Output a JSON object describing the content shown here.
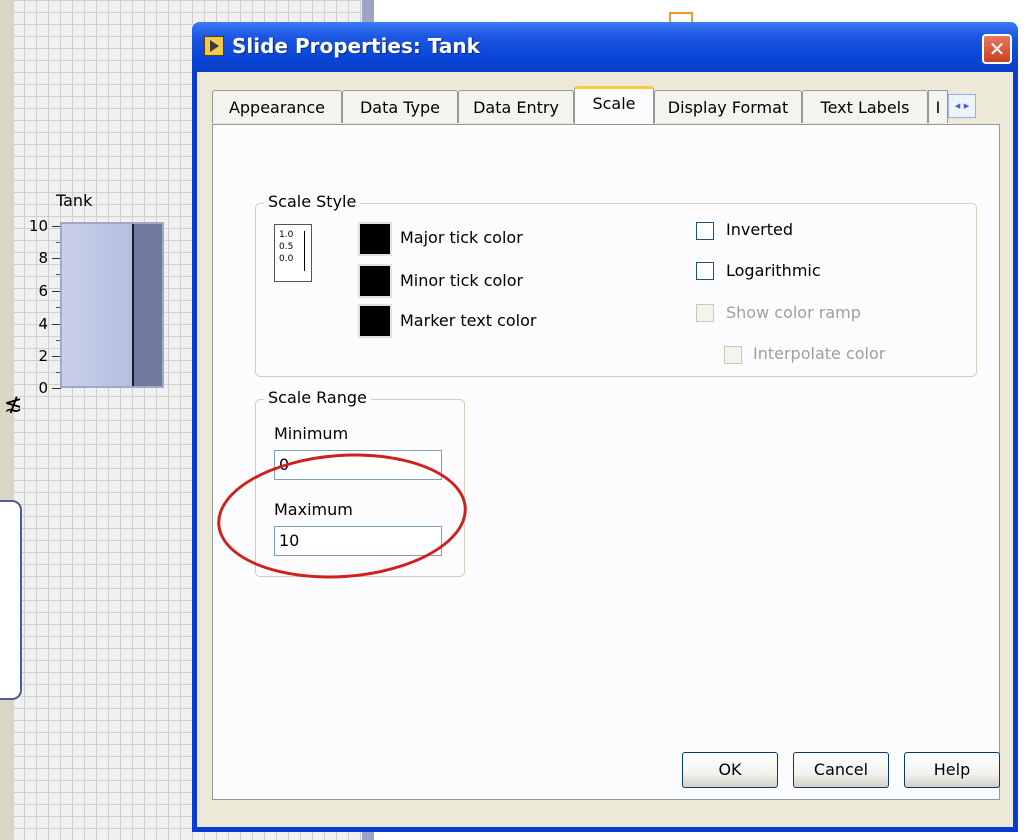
{
  "background": {
    "indicator_label": "Tank",
    "scale_ticks": [
      "10",
      "8",
      "6",
      "4",
      "2",
      "0"
    ]
  },
  "dialog": {
    "title": "Slide Properties: Tank",
    "close_glyph": "✕",
    "tabs": [
      "Appearance",
      "Data Type",
      "Data Entry",
      "Scale",
      "Display Format",
      "Text Labels",
      "I"
    ],
    "active_tab": "Scale",
    "tab_scroll_arrows": "◂ ▸",
    "scale_style": {
      "title": "Scale Style",
      "icon_labels": [
        "1.0",
        "0.5",
        "0.0"
      ],
      "colors": [
        {
          "label": "Major tick color",
          "color": "#000000"
        },
        {
          "label": "Minor tick color",
          "color": "#000000"
        },
        {
          "label": "Marker text color",
          "color": "#000000"
        }
      ],
      "options": [
        {
          "label": "Inverted",
          "checked": false,
          "enabled": true
        },
        {
          "label": "Logarithmic",
          "checked": false,
          "enabled": true
        },
        {
          "label": "Show color ramp",
          "checked": false,
          "enabled": false
        },
        {
          "label": "Interpolate color",
          "checked": false,
          "enabled": false
        }
      ]
    },
    "scale_range": {
      "title": "Scale Range",
      "minimum_label": "Minimum",
      "minimum_value": "0",
      "maximum_label": "Maximum",
      "maximum_value": "10"
    },
    "buttons": {
      "ok": "OK",
      "cancel": "Cancel",
      "help": "Help"
    }
  },
  "colors": {
    "titlebar": "#0a46d8",
    "highlight": "#d0201c",
    "active_tab_accent": "#ffc83c"
  }
}
